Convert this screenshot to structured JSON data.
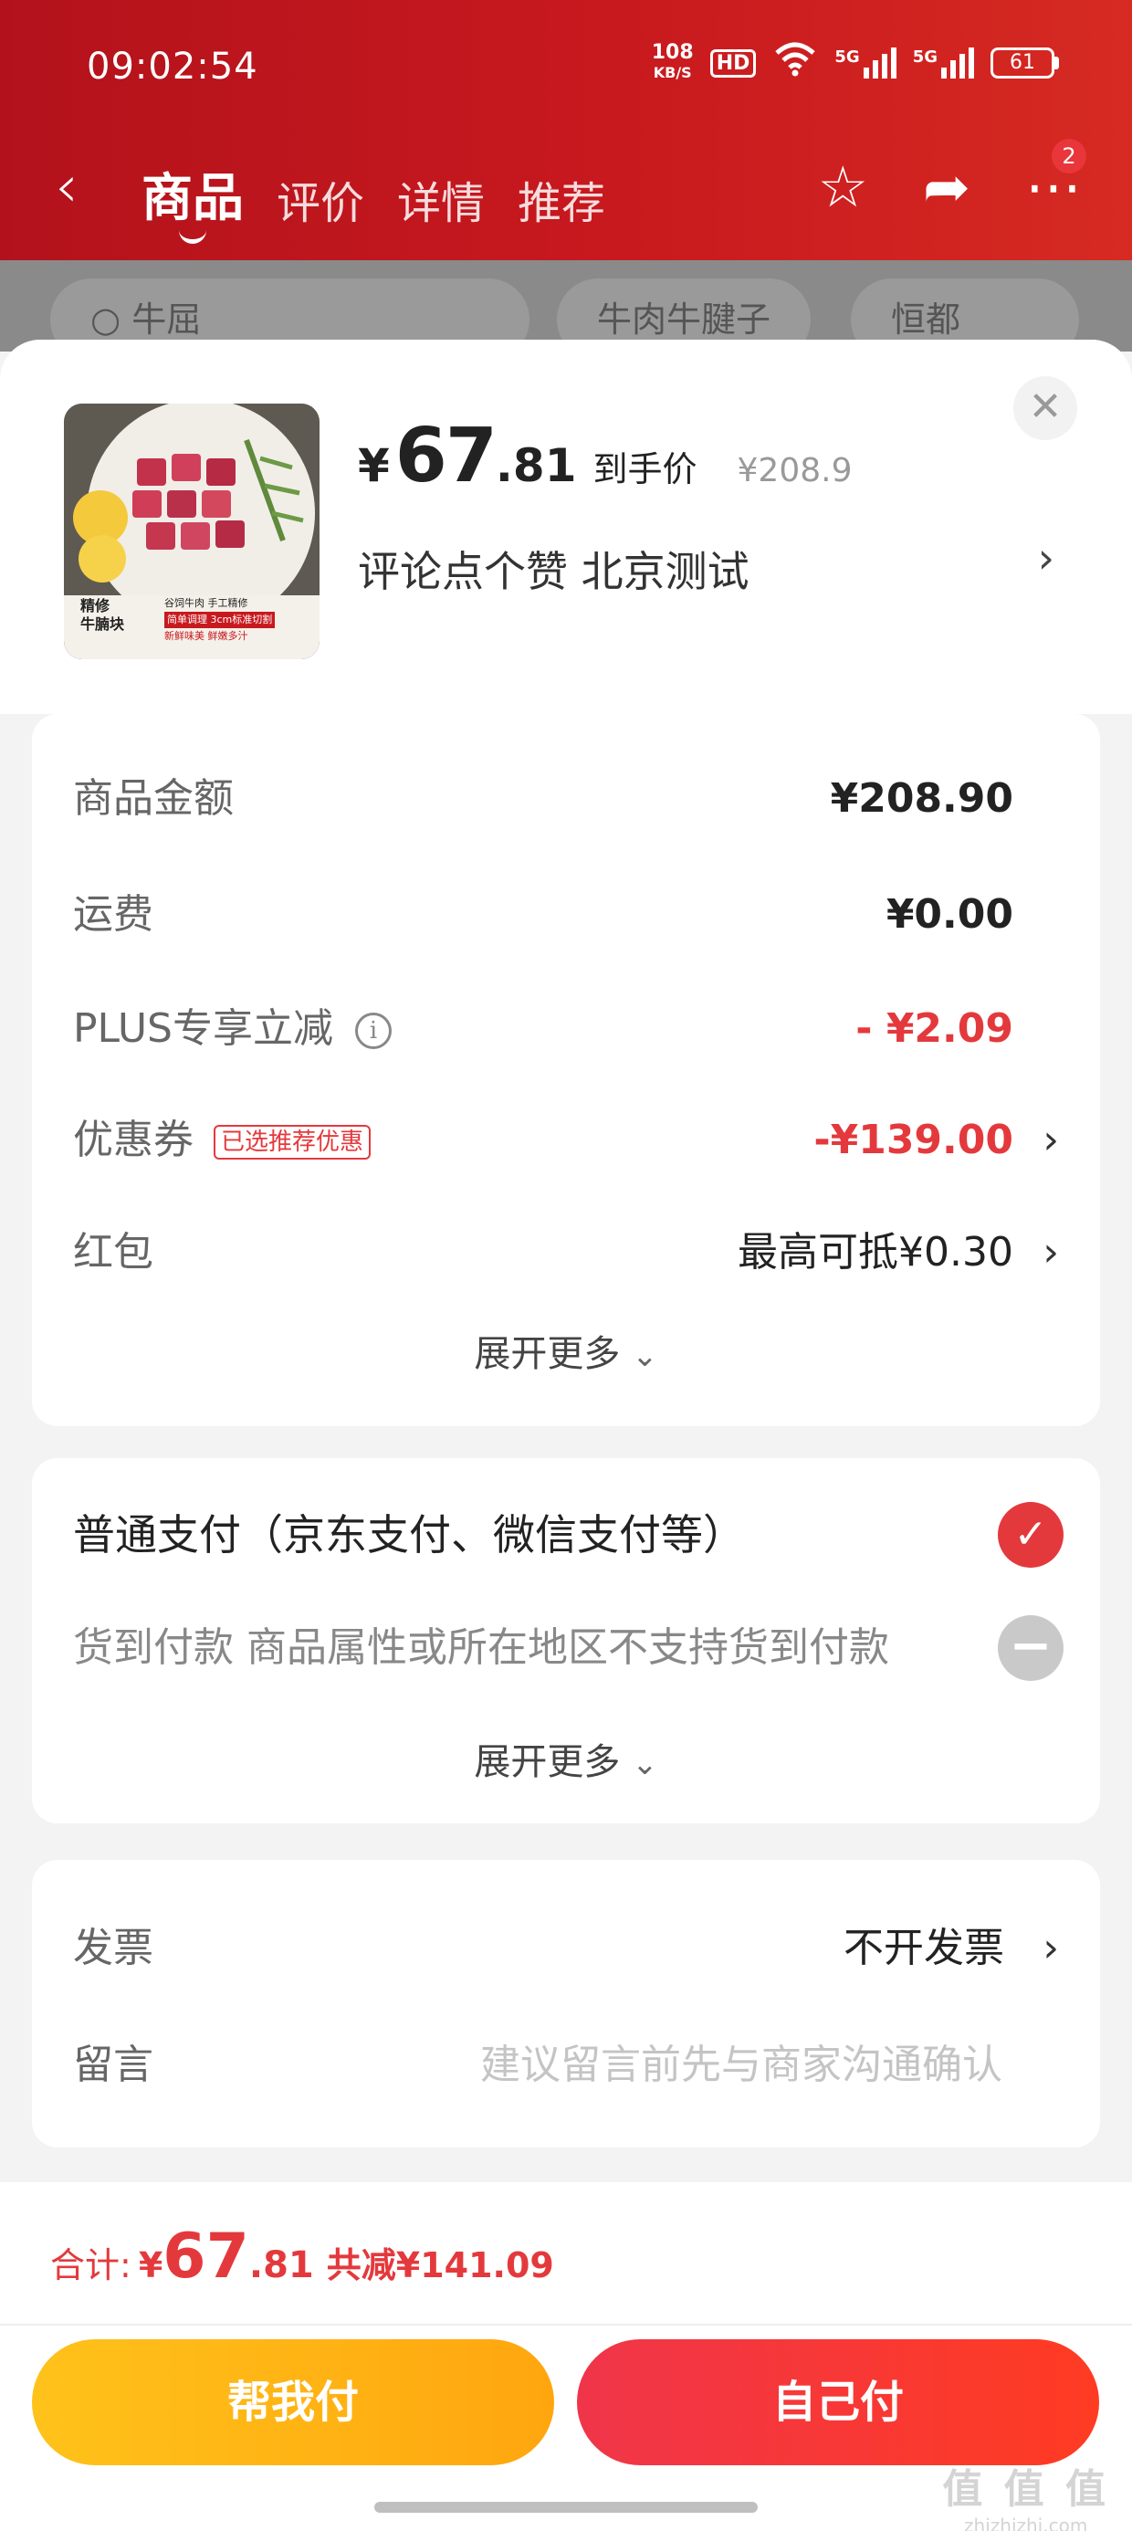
{
  "status_bar": {
    "time": "09:02:54",
    "net_speed": "108",
    "net_unit": "KB/S",
    "hd": "HD",
    "signal1": "5G",
    "signal2": "5G",
    "battery": "61"
  },
  "nav": {
    "tabs": [
      {
        "label": "商品",
        "active": true
      },
      {
        "label": "评价"
      },
      {
        "label": "详情"
      },
      {
        "label": "推荐"
      }
    ],
    "badge": "2"
  },
  "background_chips": [
    "牛屈",
    "牛肉牛腱子",
    "恒都"
  ],
  "product": {
    "price_symbol": "¥",
    "price_int": "67",
    "price_dec": ".81",
    "price_label": "到手价",
    "original_price": "¥208.9",
    "sku": "评论点个赞  北京测试",
    "image_caption_1": "精修",
    "image_caption_2": "牛腩块",
    "image_line_1": "谷饲牛肉 手工精修",
    "image_line_2": "简单调理 3cm标准切割",
    "image_line_3": "新鲜味美 鲜嫩多汁"
  },
  "amounts": {
    "goods_label": "商品金额",
    "goods_value": "¥208.90",
    "shipping_label": "运费",
    "shipping_value": "¥0.00",
    "plus_label": "PLUS专享立减",
    "plus_value": "- ¥2.09",
    "coupon_label": "优惠券",
    "coupon_tag": "已选推荐优惠",
    "coupon_value": "-¥139.00",
    "redpacket_label": "红包",
    "redpacket_value": "最高可抵¥0.30",
    "expand": "展开更多"
  },
  "payment": {
    "normal": "普通支付（京东支付、微信支付等）",
    "cod": "货到付款 商品属性或所在地区不支持货到付款",
    "expand": "展开更多"
  },
  "extra": {
    "invoice_label": "发票",
    "invoice_value": "不开发票",
    "message_label": "留言",
    "message_placeholder": "建议留言前先与商家沟通确认"
  },
  "bottom": {
    "total_label": "合计:",
    "total_symbol": "¥",
    "total_int": "67",
    "total_dec": ".81",
    "saved": "共减¥141.09",
    "help_pay": "帮我付",
    "self_pay": "自己付"
  },
  "watermark": {
    "line1": "值 值 值",
    "line2": "zhizhizhi.com"
  },
  "colors": {
    "accent": "#e4393c",
    "header": "#c8191e",
    "help_button": "#ffb414",
    "self_button": "#f5333a"
  }
}
